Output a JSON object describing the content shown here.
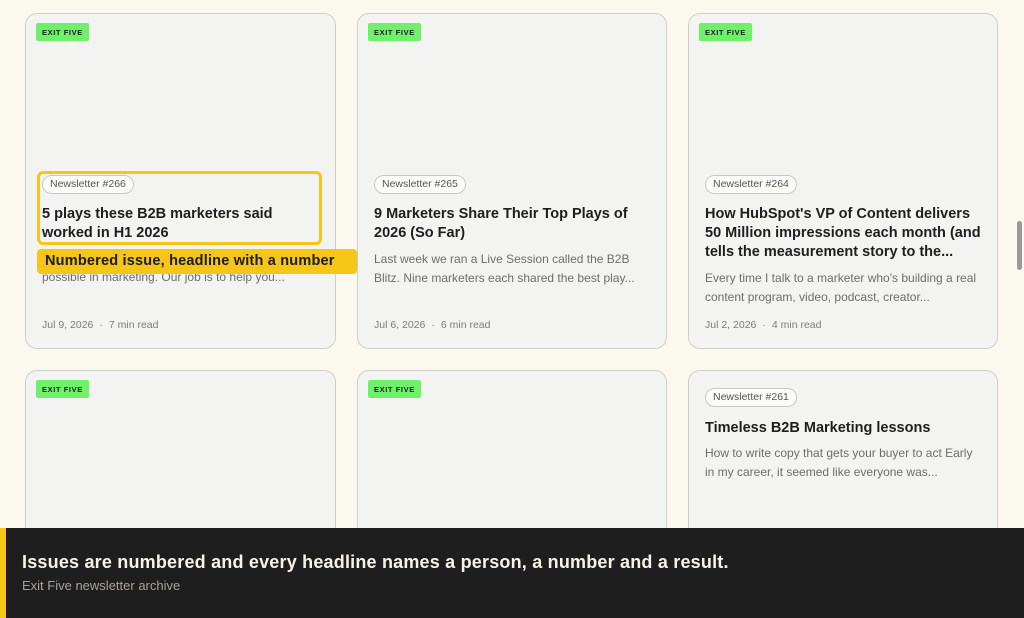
{
  "cards": [
    {
      "tag": "EXIT FIVE",
      "badge": "Newsletter #266",
      "title_lines": [
        "5 plays these B2B marketers said",
        "worked in H1 2026"
      ],
      "excerpt_lines": [
        "possible in marketing. Our job is to help you..."
      ],
      "date": "Jul 9, 2026",
      "read": "7 min read"
    },
    {
      "tag": "EXIT FIVE",
      "badge": "Newsletter #265",
      "title_lines": [
        "9 Marketers Share Their Top Plays of",
        "2026 (So Far)"
      ],
      "excerpt_lines": [
        "Last week we ran a Live Session called the B2B",
        "Blitz. Nine marketers each shared the best play..."
      ],
      "date": "Jul 6, 2026",
      "read": "6 min read"
    },
    {
      "tag": "EXIT FIVE",
      "badge": "Newsletter #264",
      "title_lines": [
        "How HubSpot's VP of Content delivers",
        "50 Million impressions each month (and",
        "tells the measurement story to the..."
      ],
      "excerpt_lines": [
        "Every time I talk to a marketer who's building a real",
        "content program, video, podcast, creator..."
      ],
      "date": "Jul 2, 2026",
      "read": "4 min read"
    },
    {
      "tag": "EXIT FIVE"
    },
    {
      "tag": "EXIT FIVE"
    },
    {
      "badge": "Newsletter #261",
      "title_lines": [
        "Timeless B2B Marketing lessons"
      ],
      "excerpt_lines": [
        "How to write copy that gets your buyer to act Early",
        "in my career, it seemed like everyone was..."
      ]
    }
  ],
  "callout": "Numbered issue, headline with a number",
  "banner": {
    "title": "Issues are numbered and every headline names a person, a number and a result.",
    "subtitle": "Exit Five newsletter archive"
  },
  "colors": {
    "background": "#fbf9ef",
    "tag_green": "#6ff06b",
    "highlight_yellow": "#f5c518",
    "banner_dark": "#1e1e1e"
  }
}
